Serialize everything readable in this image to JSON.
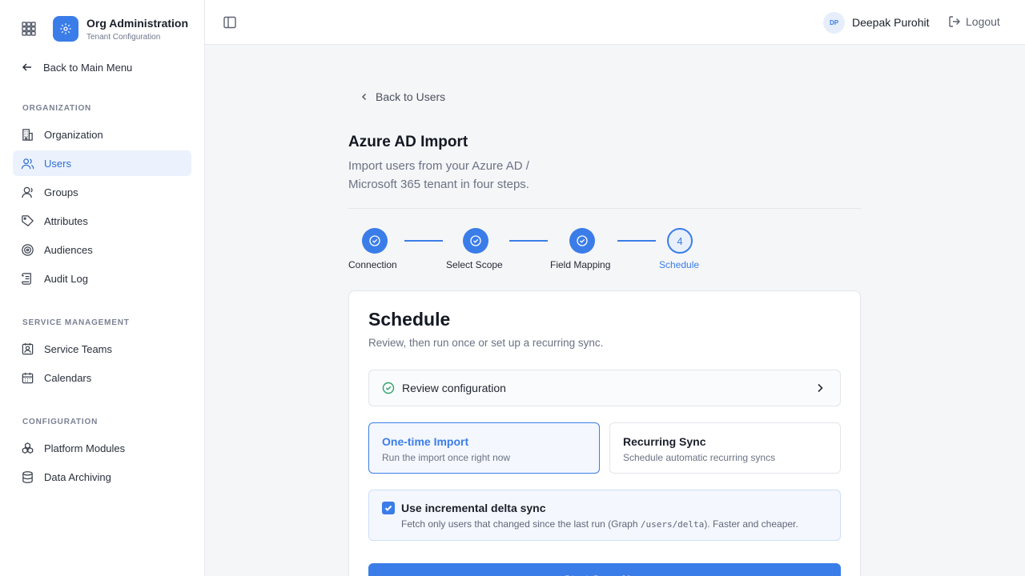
{
  "app": {
    "title": "Org Administration",
    "subtitle": "Tenant Configuration",
    "back_label": "Back to Main Menu"
  },
  "sidebar": {
    "sections": [
      {
        "label": "ORGANIZATION",
        "items": [
          {
            "label": "Organization",
            "icon": "building-icon"
          },
          {
            "label": "Users",
            "icon": "users-icon",
            "active": true
          },
          {
            "label": "Groups",
            "icon": "group-icon"
          },
          {
            "label": "Attributes",
            "icon": "tag-icon"
          },
          {
            "label": "Audiences",
            "icon": "target-icon"
          },
          {
            "label": "Audit Log",
            "icon": "scroll-icon"
          }
        ]
      },
      {
        "label": "SERVICE MANAGEMENT",
        "items": [
          {
            "label": "Service Teams",
            "icon": "contact-card-icon"
          },
          {
            "label": "Calendars",
            "icon": "calendar-icon"
          }
        ]
      },
      {
        "label": "CONFIGURATION",
        "items": [
          {
            "label": "Platform Modules",
            "icon": "modules-icon"
          },
          {
            "label": "Data Archiving",
            "icon": "database-icon"
          }
        ]
      }
    ]
  },
  "topbar": {
    "avatar_initials": "DP",
    "user_name": "Deepak Purohit",
    "logout_label": "Logout"
  },
  "main": {
    "back_label": "Back to Users",
    "title": "Azure AD Import",
    "subtitle": "Import users from your Azure AD / Microsoft 365 tenant in four steps.",
    "steps": [
      {
        "label": "Connection",
        "state": "complete"
      },
      {
        "label": "Select Scope",
        "state": "complete"
      },
      {
        "label": "Field Mapping",
        "state": "complete"
      },
      {
        "label": "Schedule",
        "state": "current",
        "number": "4"
      }
    ]
  },
  "card": {
    "title": "Schedule",
    "subtitle": "Review, then run once or set up a recurring sync.",
    "review_label": "Review configuration",
    "options": [
      {
        "title": "One-time Import",
        "subtitle": "Run the import once right now",
        "selected": true
      },
      {
        "title": "Recurring Sync",
        "subtitle": "Schedule automatic recurring syncs",
        "selected": false
      }
    ],
    "delta": {
      "checked": true,
      "title": "Use incremental delta sync",
      "desc_before": "Fetch only users that changed since the last run (Graph ",
      "desc_code": "/users/delta",
      "desc_after": "). Faster and cheaper."
    },
    "primary_button": "Start Sync Now"
  },
  "colors": {
    "accent": "#3b7de8",
    "active_bg": "#ebf2fd",
    "success": "#2fa36b"
  }
}
